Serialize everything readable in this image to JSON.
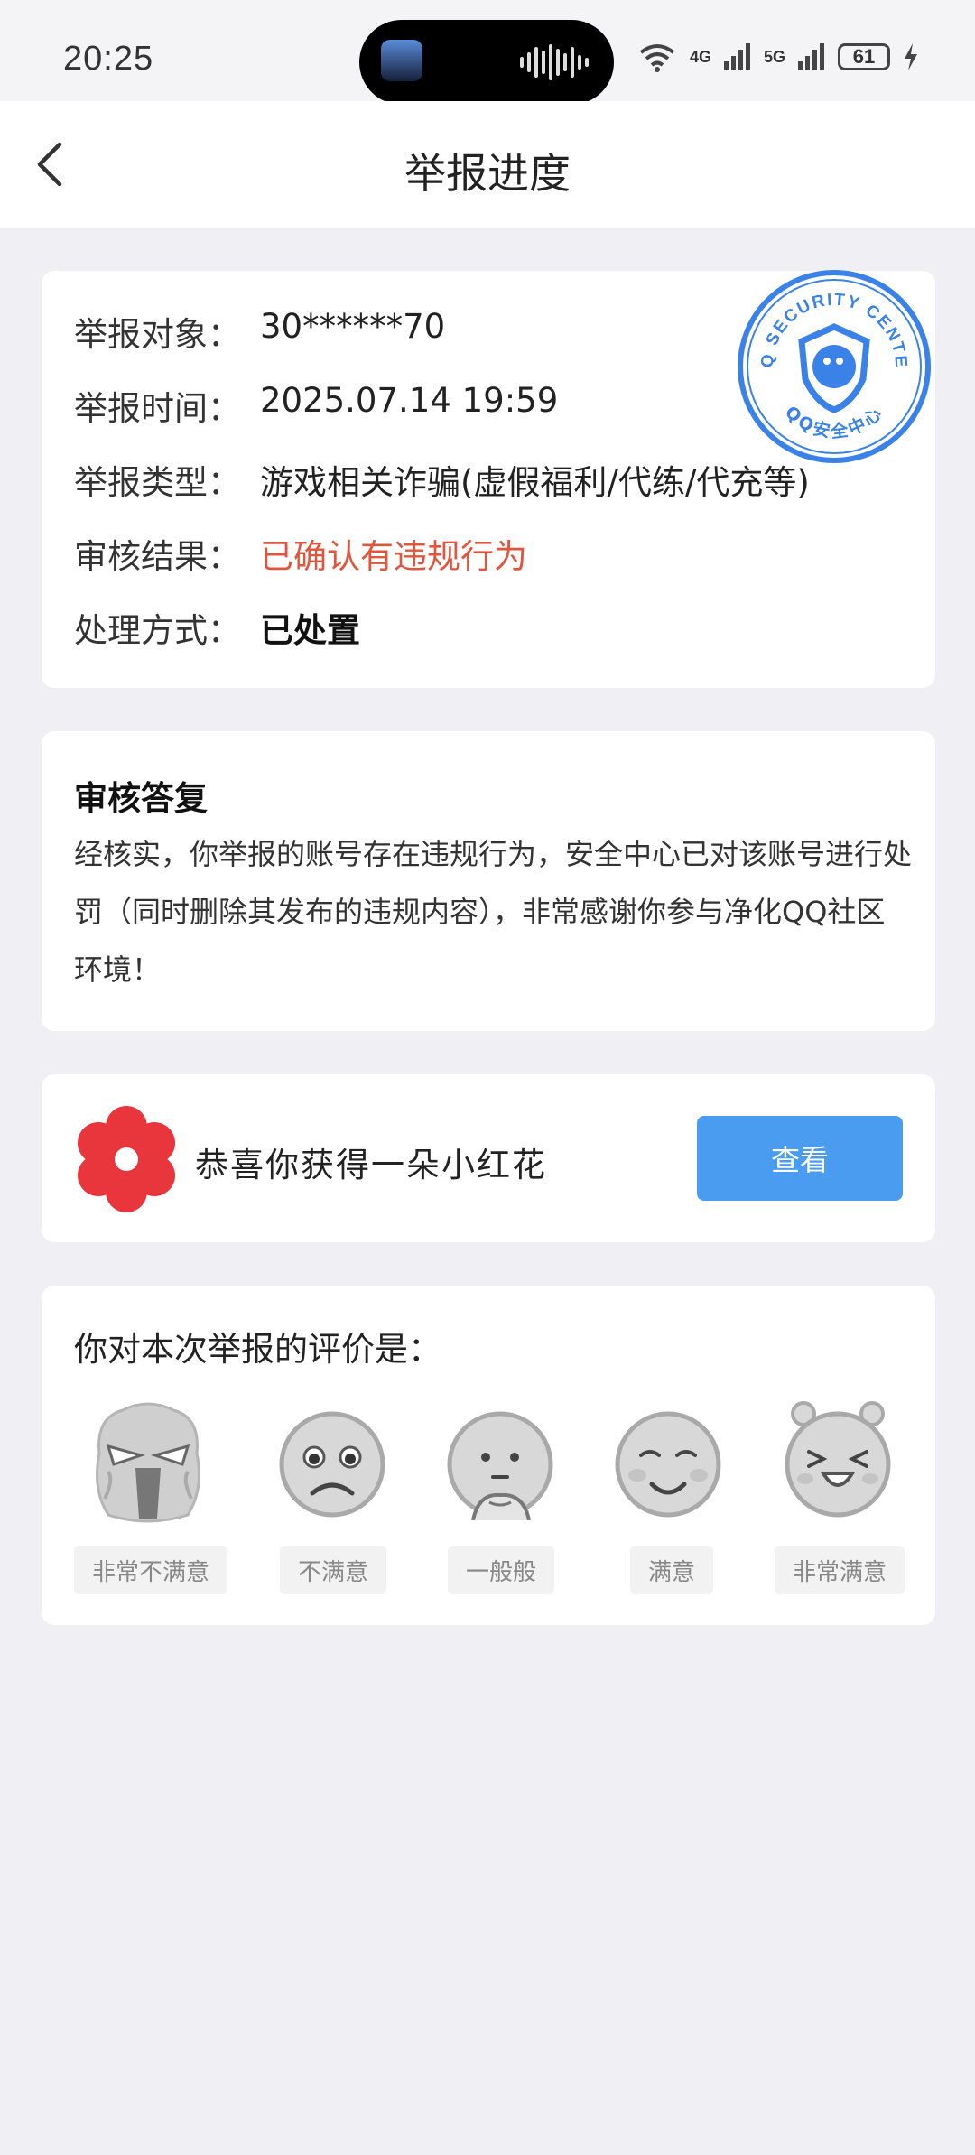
{
  "status_bar": {
    "time": "20:25",
    "signal_4g": "4G",
    "signal_5g": "5G",
    "battery": "61"
  },
  "header": {
    "title": "举报进度"
  },
  "report_info": {
    "rows": [
      {
        "label": "举报对象：",
        "value": "30******70"
      },
      {
        "label": "举报时间：",
        "value": "2025.07.14 19:59"
      },
      {
        "label": "举报类型：",
        "value": "游戏相关诈骗(虚假福利/代练/代充等)"
      },
      {
        "label": "审核结果：",
        "value": "已确认有违规行为"
      },
      {
        "label": "处理方式：",
        "value": "已处置"
      }
    ],
    "stamp_top_text": "QQ SECURITY CENTER",
    "stamp_bottom_text": "QQ安全中心"
  },
  "review_reply": {
    "title": "审核答复",
    "text": "经核实，你举报的账号存在违规行为，安全中心已对该账号进行处罚（同时删除其发布的违规内容），非常感谢你参与净化QQ社区环境！"
  },
  "reward": {
    "text": "恭喜你获得一朵小红花",
    "button_label": "查看"
  },
  "rating": {
    "title": "你对本次举报的评价是：",
    "options": [
      {
        "label": "非常不满意",
        "icon": "very-dissatisfied-face-icon"
      },
      {
        "label": "不满意",
        "icon": "dissatisfied-face-icon"
      },
      {
        "label": "一般般",
        "icon": "neutral-face-icon"
      },
      {
        "label": "满意",
        "icon": "satisfied-face-icon"
      },
      {
        "label": "非常满意",
        "icon": "very-satisfied-face-icon"
      }
    ]
  },
  "colors": {
    "accent_blue": "#4a9cf1",
    "result_red": "#e0553c",
    "flower_red": "#e8363c",
    "page_bg": "#efeff4"
  }
}
